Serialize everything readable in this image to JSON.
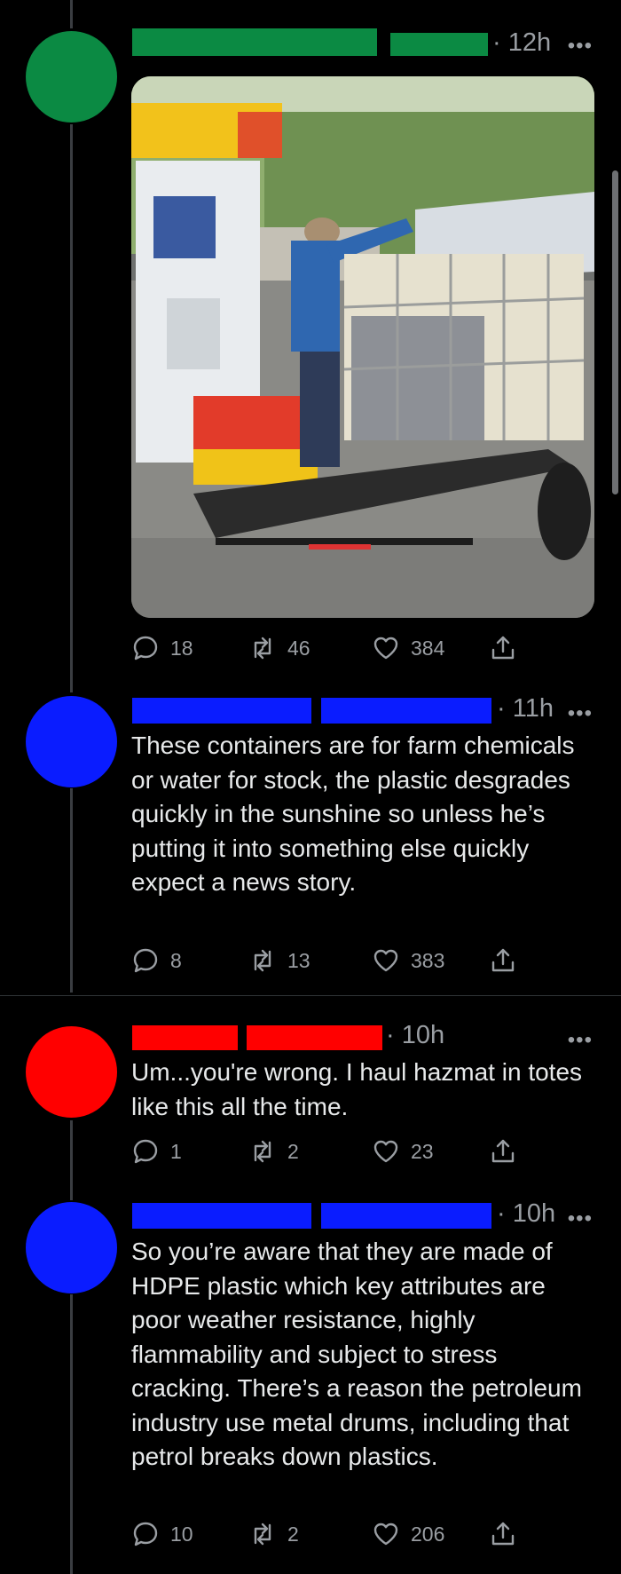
{
  "colors": {
    "post1_accent": "#0b8a43",
    "post2_accent": "#0a1cff",
    "post3_accent": "#ff0000",
    "post4_accent": "#0a1cff"
  },
  "posts": [
    {
      "time": "· 12h",
      "more_icon": "more-horizontal-icon",
      "has_image": true,
      "image_alt": "",
      "replies": "18",
      "retweets": "46",
      "likes": "384"
    },
    {
      "time": "· 11h",
      "text": "These containers are for farm chemicals or water for stock, the plastic desgrades quickly in the sunshine so unless he’s putting it into something else quickly expect a news story.",
      "replies": "8",
      "retweets": "13",
      "likes": "383"
    },
    {
      "time": "· 10h",
      "text": "Um...you're wrong.  I haul hazmat in totes like this all the time.",
      "replies": "1",
      "retweets": "2",
      "likes": "23"
    },
    {
      "time": "· 10h",
      "text": "So you’re aware that they are made of HDPE plastic which key attributes are poor weather resistance, highly flammability and subject to stress cracking. There’s a reason the petroleum industry use metal drums, including that petrol breaks down plastics.",
      "replies": "10",
      "retweets": "2",
      "likes": "206"
    }
  ]
}
